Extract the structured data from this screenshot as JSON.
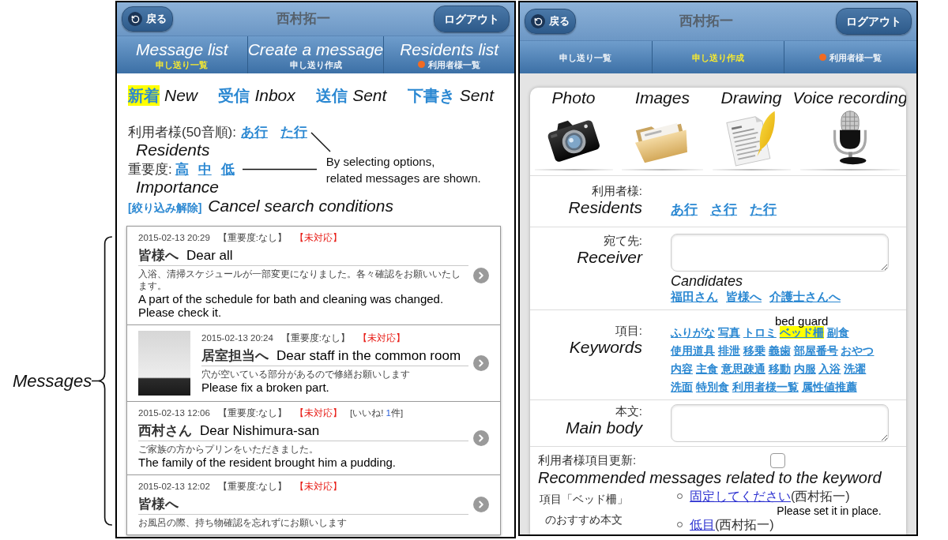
{
  "left_screen": {
    "header": {
      "back": "戻る",
      "title": "西村拓一",
      "logout": "ログアウト"
    },
    "tabs": [
      {
        "label": "申し送り一覧",
        "note": "Message list",
        "selected": true,
        "dot": false
      },
      {
        "label": "申し送り作成",
        "note": "Create a message",
        "selected": false,
        "dot": false
      },
      {
        "label": "利用者様一覧",
        "note": "Residents list",
        "selected": false,
        "dot": true
      }
    ],
    "filters": [
      {
        "label": "新着",
        "note": "New",
        "selected": true
      },
      {
        "label": "受信",
        "note": "Inbox",
        "selected": false
      },
      {
        "label": "送信",
        "note": "Sent",
        "selected": false
      },
      {
        "label": "下書き",
        "note": "Sent",
        "selected": false
      }
    ],
    "residents": {
      "label": "利用者様(50音順):",
      "options": [
        "あ行",
        "た行"
      ],
      "note": "Residents"
    },
    "importance": {
      "label": "重要度:",
      "options": [
        "高",
        "中",
        "低"
      ],
      "note": "Importance"
    },
    "callout": "By selecting options,\nrelated messages are shown.",
    "clear": {
      "label": "[絞り込み解除]",
      "note": "Cancel search conditions"
    },
    "messages_note": "Messages",
    "messages": [
      {
        "time": "2015-02-13 20:29",
        "importance": "【重要度:なし】",
        "status": "【未対応】",
        "title": "皆様へ",
        "title_note": "Dear all",
        "body": "入浴、清掃スケジュールが一部変更になりました。各々確認をお願いいたします。",
        "body_note": "A part of the schedule for bath and cleaning was changed. Please check it.",
        "photo": false
      },
      {
        "time": "2015-02-13 20:24",
        "importance": "【重要度:なし】",
        "status": "【未対応】",
        "title": "居室担当へ",
        "title_note": "Dear staff in the common room",
        "body": "穴が空いている部分があるので修繕お願いします",
        "body_note": "Please fix a broken part.",
        "photo": true
      },
      {
        "time": "2015-02-13 12:06",
        "importance": "【重要度:なし】",
        "status": "【未対応】",
        "likes": {
          "label": "[いいね!",
          "count": "1",
          "unit": "件]"
        },
        "title": "西村さん",
        "title_note": "Dear Nishimura-san",
        "body": "ご家族の方からプリンをいただきました。",
        "body_note": "The family of the resident brought him a pudding.",
        "photo": false
      },
      {
        "time": "2015-02-13 12:02",
        "importance": "【重要度:なし】",
        "status": "【未対応】",
        "title": "皆様へ",
        "body": "お風呂の際、持ち物確認を忘れずにお願いします",
        "photo": false
      }
    ]
  },
  "right_screen": {
    "header": {
      "back": "戻る",
      "title": "西村拓一",
      "logout": "ログアウト"
    },
    "tabs": [
      {
        "label": "申し送り一覧",
        "selected": false,
        "dot": false
      },
      {
        "label": "申し送り作成",
        "selected": true,
        "dot": false
      },
      {
        "label": "利用者様一覧",
        "selected": false,
        "dot": true
      }
    ],
    "tools": [
      {
        "kind": "camera",
        "note": "Photo"
      },
      {
        "kind": "folder",
        "note": "Images"
      },
      {
        "kind": "document",
        "note": "Drawing"
      },
      {
        "kind": "microphone",
        "note": "Voice recording"
      }
    ],
    "residents": {
      "label": "利用者様:",
      "note": "Residents",
      "options": [
        "あ行",
        "さ行",
        "た行"
      ]
    },
    "receiver": {
      "label": "宛て先:",
      "note": "Receiver",
      "candidates_note": "Candidates",
      "candidates": [
        "福田さん",
        "皆様へ",
        "介護士さんへ"
      ]
    },
    "keywords": {
      "label": "項目:",
      "note": "Keywords",
      "items": [
        {
          "label": "ふりがな",
          "selected": false
        },
        {
          "label": "写真",
          "selected": false
        },
        {
          "label": "トロミ",
          "selected": false
        },
        {
          "label": "ベッド柵",
          "selected": true,
          "note": "bed guard"
        },
        {
          "label": "副食",
          "selected": false
        },
        {
          "label": "使用道具",
          "selected": false
        },
        {
          "label": "排泄",
          "selected": false
        },
        {
          "label": "移乗",
          "selected": false
        },
        {
          "label": "義歯",
          "selected": false
        },
        {
          "label": "部屋番号",
          "selected": false
        },
        {
          "label": "おやつ",
          "selected": false
        },
        {
          "label": "内容",
          "selected": false
        },
        {
          "label": "主食",
          "selected": false
        },
        {
          "label": "意思疎通",
          "selected": false
        },
        {
          "label": "移動",
          "selected": false
        },
        {
          "label": "内服",
          "selected": false
        },
        {
          "label": "入浴",
          "selected": false
        },
        {
          "label": "洗濯",
          "selected": false
        },
        {
          "label": "洗面",
          "selected": false
        },
        {
          "label": "特別食",
          "selected": false
        },
        {
          "label": "利用者様一覧",
          "selected": false
        },
        {
          "label": "属性値推薦",
          "selected": false
        }
      ]
    },
    "body": {
      "label": "本文:",
      "note": "Main body"
    },
    "update": {
      "label": "利用者様項目更新:",
      "checked": false,
      "note": "Recommended messages related to the keyword"
    },
    "recommendations": {
      "label": "項目「ベッド柵」のおすすめ本文",
      "items": [
        {
          "text": "固定してください",
          "author": "(西村拓一)",
          "note": "Please set it in place."
        },
        {
          "text": "低目",
          "author": "(西村拓一)"
        }
      ]
    }
  }
}
